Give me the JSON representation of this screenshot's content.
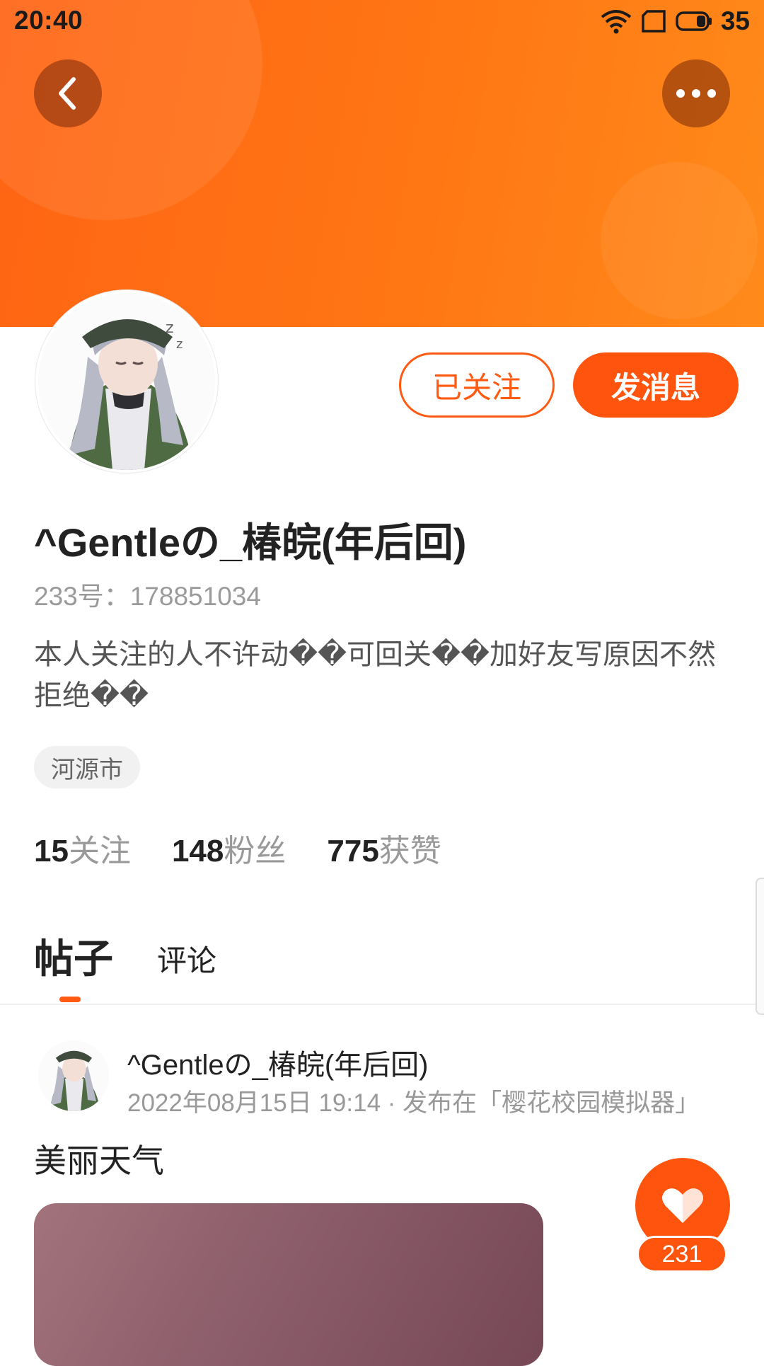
{
  "status_bar": {
    "time": "20:40",
    "battery": "35"
  },
  "header": {
    "back_icon": "chevron-left-icon",
    "more_icon": "more-dots-icon",
    "accent": "#ff6413"
  },
  "profile": {
    "name": "^Gentleの_椿皖(年后回)",
    "uid": "233号：178851034",
    "bio": "本人关注的人不许动��可回关��加好友写原因不然拒绝��",
    "location": "河源市",
    "follow_button": "已关注",
    "message_button": "发消息",
    "stats": [
      {
        "value": "15",
        "label": "关注"
      },
      {
        "value": "148",
        "label": "粉丝"
      },
      {
        "value": "775",
        "label": "获赞"
      }
    ]
  },
  "tabs": [
    {
      "label": "帖子",
      "active": true
    },
    {
      "label": "评论",
      "active": false
    }
  ],
  "post": {
    "author": "^Gentleの_椿皖(年后回)",
    "meta": "2022年08月15日 19:14 · 发布在「樱花校园模拟器」",
    "title": "美丽天气",
    "likes": "231"
  }
}
